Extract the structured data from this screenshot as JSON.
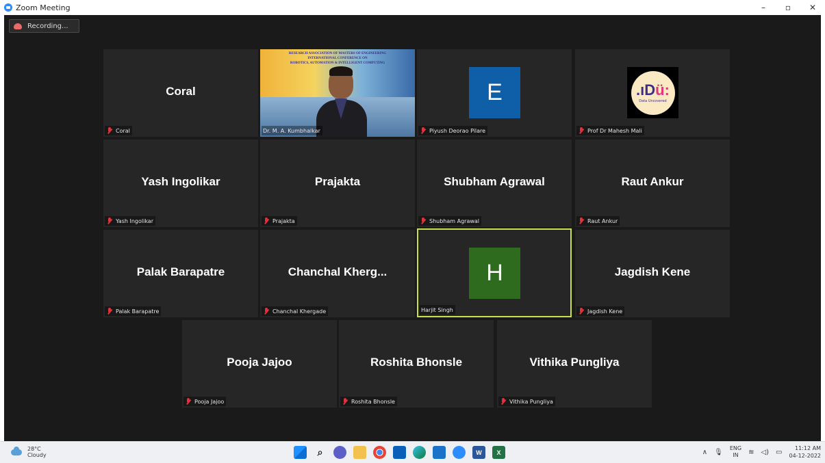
{
  "window": {
    "title": "Zoom Meeting",
    "minimize": "–",
    "maximize": "▫",
    "close": "✕"
  },
  "recording": {
    "label": "Recording..."
  },
  "tiles": [
    {
      "big": "Coral",
      "caption": "Coral",
      "muted": true
    },
    {
      "big": "",
      "caption": "Dr. M. A. Kumbhalkar",
      "muted": false,
      "video": true
    },
    {
      "big": "",
      "caption": "Piyush Deorao Pilare",
      "muted": true,
      "avatar_letter": "E",
      "avatar_color": "#0e5ea8"
    },
    {
      "big": "",
      "caption": "Prof Dr Mahesh Mali",
      "muted": true,
      "logo": true
    },
    {
      "big": "Yash Ingolikar",
      "caption": "Yash Ingolikar",
      "muted": true
    },
    {
      "big": "Prajakta",
      "caption": "Prajakta",
      "muted": true
    },
    {
      "big": "Shubham Agrawal",
      "caption": "Shubham Agrawal",
      "muted": true
    },
    {
      "big": "Raut Ankur",
      "caption": "Raut Ankur",
      "muted": true
    },
    {
      "big": "Palak Barapatre",
      "caption": "Palak Barapatre",
      "muted": true
    },
    {
      "big": "Chanchal Kherg...",
      "caption": "Chanchal Khergade",
      "muted": true
    },
    {
      "big": "",
      "caption": "Harjit Singh",
      "muted": false,
      "avatar_letter": "H",
      "avatar_color": "#2e6b1f",
      "active_speaker": true
    },
    {
      "big": "Jagdish Kene",
      "caption": "Jagdish Kene",
      "muted": true
    },
    {
      "big": "Pooja Jajoo",
      "caption": "Pooja Jajoo",
      "muted": true
    },
    {
      "big": "Roshita Bhonsle",
      "caption": "Roshita Bhonsle",
      "muted": true
    },
    {
      "big": "Vithika Pungliya",
      "caption": "Vithika Pungliya",
      "muted": true
    }
  ],
  "video_banner": {
    "line1": "RESEARCH ASSOCIATION OF MASTERS OF ENGINEERING",
    "line2": "INTERNATIONAL CONFERENCE ON",
    "line3": "ROBOTICS, AUTOMATION & INTELLIGENT COMPUTING"
  },
  "logo": {
    "mark_left": ".ıD",
    "mark_right": "ü:",
    "sub": "Data Uncovered"
  },
  "taskbar": {
    "temperature": "28°C",
    "condition": "Cloudy",
    "lang_top": "ENG",
    "lang_bottom": "IN",
    "time": "11:12 AM",
    "date": "04-12-2022",
    "chevron": "∧"
  },
  "colors": {
    "active_speaker_border": "#c9e04a",
    "muted_icon": "#e0323b",
    "stage_bg": "#1a1a1a",
    "tile_bg": "#262626"
  }
}
